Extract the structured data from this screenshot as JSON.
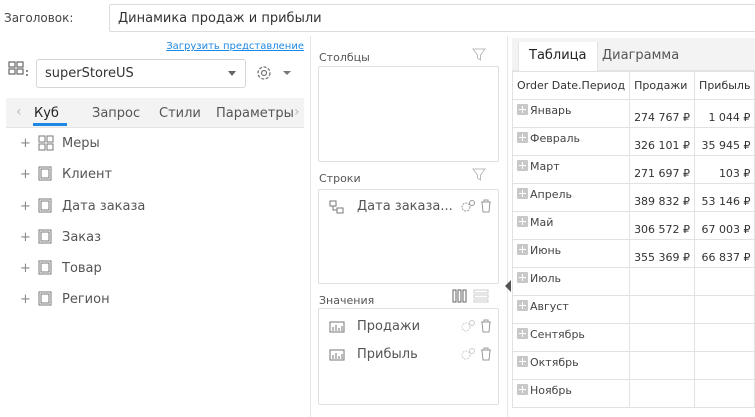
{
  "header": {
    "label": "Заголовок:",
    "title_value": "Динамика продаж и прибыли"
  },
  "left": {
    "load_link": "Загрузить представление",
    "datasource": "superStoreUS",
    "tabs": [
      "Куб",
      "Запрос",
      "Стили",
      "Параметры"
    ],
    "tree": [
      "Меры",
      "Клиент",
      "Дата заказа",
      "Заказ",
      "Товар",
      "Регион"
    ]
  },
  "middle": {
    "columns_label": "Столбцы",
    "rows_label": "Строки",
    "rows_items": [
      "Дата заказа..."
    ],
    "values_label": "Значения",
    "values_items": [
      "Продажи",
      "Прибыль"
    ]
  },
  "right": {
    "tabs": [
      "Таблица",
      "Диаграмма"
    ],
    "table": {
      "headers": [
        "Order Date.Период",
        "Продажи",
        "Прибыль"
      ],
      "rows": [
        [
          "Январь",
          "274 767 ₽",
          "1 044 ₽"
        ],
        [
          "Февраль",
          "326 101 ₽",
          "35 945 ₽"
        ],
        [
          "Март",
          "271 697 ₽",
          "103 ₽"
        ],
        [
          "Апрель",
          "389 832 ₽",
          "53 146 ₽"
        ],
        [
          "Май",
          "306 572 ₽",
          "67 003 ₽"
        ],
        [
          "Июнь",
          "355 369 ₽",
          "66 837 ₽"
        ],
        [
          "Июль",
          "",
          ""
        ],
        [
          "Август",
          "",
          ""
        ],
        [
          "Сентябрь",
          "",
          ""
        ],
        [
          "Октябрь",
          "",
          ""
        ],
        [
          "Ноябрь",
          "",
          ""
        ]
      ]
    }
  },
  "colors": {
    "accent": "#1e88e5",
    "border": "#e0e0e0",
    "tab_bg": "#f3f3f3"
  }
}
